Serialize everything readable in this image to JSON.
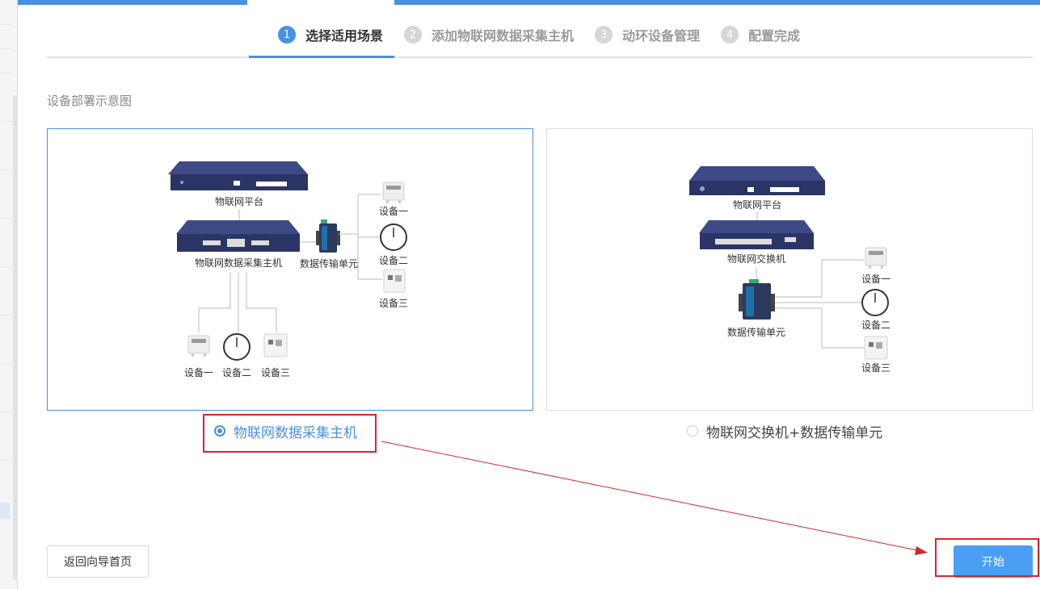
{
  "steps": [
    {
      "num": "1",
      "label": "选择适用场景",
      "active": true
    },
    {
      "num": "2",
      "label": "添加物联网数据采集主机",
      "active": false
    },
    {
      "num": "3",
      "label": "动环设备管理",
      "active": false
    },
    {
      "num": "4",
      "label": "配置完成",
      "active": false
    }
  ],
  "section_title": "设备部署示意图",
  "diagram1": {
    "platform": "物联网平台",
    "host": "物联网数据采集主机",
    "dtu": "数据传输单元",
    "device1": "设备一",
    "device2": "设备二",
    "device3": "设备三"
  },
  "diagram2": {
    "platform": "物联网平台",
    "switch": "物联网交换机",
    "dtu": "数据传输单元",
    "device1": "设备一",
    "device2": "设备二",
    "device3": "设备三"
  },
  "options": [
    {
      "label": "物联网数据采集主机",
      "checked": true
    },
    {
      "label": "物联网交换机+数据传输单元",
      "checked": false
    }
  ],
  "buttons": {
    "back": "返回向导首页",
    "start": "开始"
  },
  "colors": {
    "accent": "#4a90e2",
    "highlight": "#d9262c",
    "device_body": "#2b3565"
  }
}
